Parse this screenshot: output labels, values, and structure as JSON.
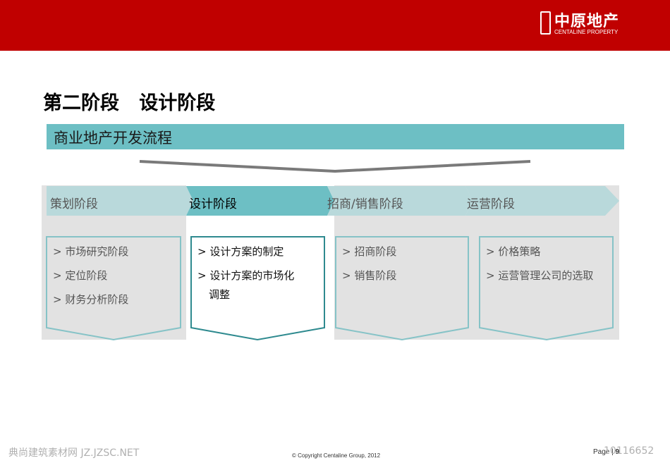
{
  "header": {
    "brand_cn": "中原地产",
    "brand_en": "CENTALINE PROPERTY",
    "seal_text": "中原",
    "colors": {
      "bar": "#c00000",
      "text": "#ffffff"
    }
  },
  "page_title": "第二阶段   设计阶段",
  "banner": {
    "text": "商业地产开发流程",
    "color": "#6dbfc4"
  },
  "stages": [
    {
      "label": "策划阶段",
      "active": false,
      "items": [
        "> 市场研究阶段",
        "> 定位阶段",
        "> 财务分析阶段"
      ]
    },
    {
      "label": "设计阶段",
      "active": true,
      "items": [
        "> 设计方案的制定",
        "> 设计方案的市场化",
        "调整"
      ]
    },
    {
      "label": "招商/销售阶段",
      "active": false,
      "items": [
        "> 招商阶段",
        "> 销售阶段"
      ]
    },
    {
      "label": "运营阶段",
      "active": false,
      "items": [
        "> 价格策略",
        "> 运营管理公司的选取"
      ]
    }
  ],
  "footer": {
    "copyright": "© Copyright  Centaline Group, 2012",
    "page_prefix": "Page",
    "page_number": "9"
  },
  "watermark": {
    "left": "典尚建筑素材网 JZ.JZSC.NET",
    "right": "10116652"
  },
  "colors": {
    "accent": "#6dbfc4",
    "inactive_arrow": "#b9d9db",
    "card_border": "#2e8a8f",
    "panel_gray": "#e2e2e2",
    "inactive_text": "#555555"
  }
}
